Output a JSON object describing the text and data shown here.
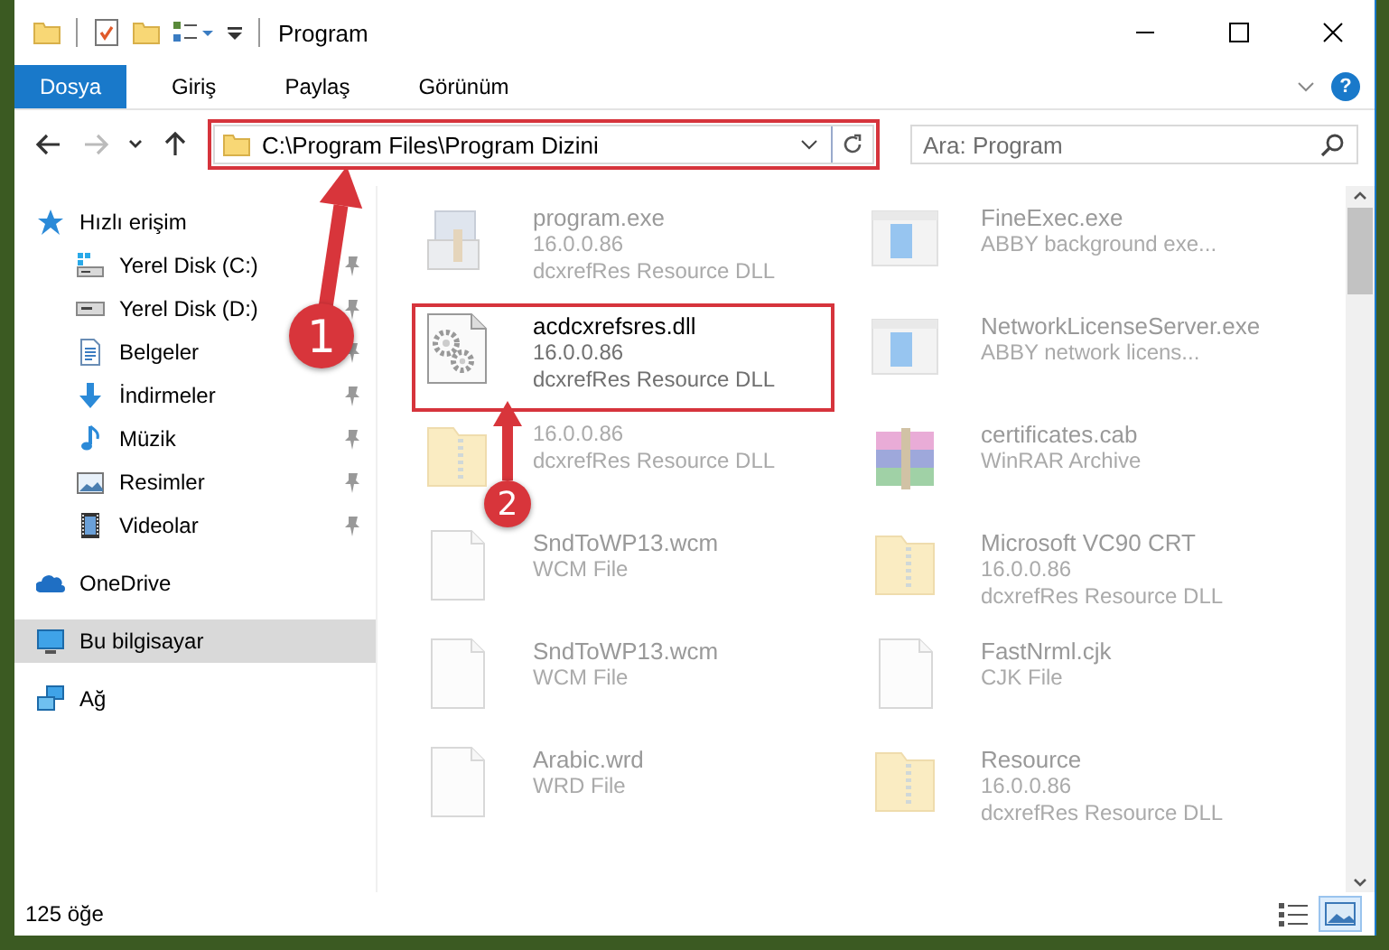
{
  "window": {
    "title": "Program"
  },
  "ribbon": {
    "tabs": [
      {
        "label": "Dosya",
        "selected": true
      },
      {
        "label": "Giriş",
        "selected": false
      },
      {
        "label": "Paylaş",
        "selected": false
      },
      {
        "label": "Görünüm",
        "selected": false
      }
    ],
    "help": "?"
  },
  "navigation": {
    "buttons": [
      {
        "kind": "back",
        "disabled": false
      },
      {
        "kind": "forward",
        "disabled": true
      },
      {
        "kind": "recent",
        "disabled": false
      },
      {
        "kind": "up",
        "disabled": false
      }
    ]
  },
  "address": {
    "value": "C:\\Program Files\\Program Dizini",
    "outlined": true
  },
  "search": {
    "placeholder": "Ara: Program"
  },
  "sidebar": {
    "items": [
      {
        "label": "Hızlı erişim",
        "kind": "star",
        "selected": false,
        "children": [
          {
            "label": "Yerel Disk (C:)",
            "kind": "drive-win",
            "selected": false,
            "pinned": true
          },
          {
            "label": "Yerel Disk (D:)",
            "kind": "drive",
            "selected": false,
            "pinned": true
          },
          {
            "label": "Belgeler",
            "kind": "document",
            "selected": false,
            "pinned": true
          },
          {
            "label": "İndirmeler",
            "kind": "download",
            "selected": false,
            "pinned": true
          },
          {
            "label": "Müzik",
            "kind": "music",
            "selected": false,
            "pinned": true
          },
          {
            "label": "Resimler",
            "kind": "picture",
            "selected": false,
            "pinned": true
          },
          {
            "label": "Videolar",
            "kind": "film",
            "selected": false,
            "pinned": true
          }
        ]
      },
      {
        "label": "OneDrive",
        "kind": "cloud",
        "selected": false
      },
      {
        "label": "Bu bilgisayar",
        "kind": "monitor",
        "selected": true
      },
      {
        "label": "Ağ",
        "kind": "network",
        "selected": false
      }
    ]
  },
  "files": [
    {
      "name": "program.exe",
      "lines": [
        "16.0.0.86",
        "dcxrefRes Resource DLL"
      ],
      "kind": "installer",
      "dimmed": true,
      "outlined": false
    },
    {
      "name": "FineExec.exe",
      "lines": [
        "ABBY background exe..."
      ],
      "kind": "app",
      "dimmed": true,
      "outlined": false
    },
    {
      "name": "acdcxrefsres.dll",
      "lines": [
        "16.0.0.86",
        "dcxrefRes Resource DLL"
      ],
      "kind": "gear",
      "dimmed": false,
      "outlined": true
    },
    {
      "name": "NetworkLicenseServer.exe",
      "lines": [
        "ABBY network licens..."
      ],
      "kind": "app",
      "dimmed": true,
      "outlined": false
    },
    {
      "lines": [
        "16.0.0.86",
        "dcxrefRes Resource DLL"
      ],
      "kind": "zip-folder",
      "dimmed": true,
      "outlined": false
    },
    {
      "name": "certificates.cab",
      "lines": [
        "WinRAR Archive"
      ],
      "kind": "archive",
      "dimmed": true,
      "outlined": false
    },
    {
      "name": "SndToWP13.wcm",
      "lines": [
        "WCM File"
      ],
      "kind": "blank",
      "dimmed": true,
      "outlined": false
    },
    {
      "name": "Microsoft VC90 CRT",
      "lines": [
        "16.0.0.86",
        "dcxrefRes Resource DLL"
      ],
      "kind": "zip-folder",
      "dimmed": true,
      "outlined": false
    },
    {
      "name": "SndToWP13.wcm",
      "lines": [
        "WCM File"
      ],
      "kind": "blank",
      "dimmed": true,
      "outlined": false
    },
    {
      "name": "FastNrml.cjk",
      "lines": [
        "CJK File"
      ],
      "kind": "blank",
      "dimmed": true,
      "outlined": false
    },
    {
      "name": "Arabic.wrd",
      "lines": [
        "WRD File"
      ],
      "kind": "blank",
      "dimmed": true,
      "outlined": false
    },
    {
      "name": "Resource",
      "lines": [
        "16.0.0.86",
        "dcxrefRes Resource DLL"
      ],
      "kind": "zip-folder",
      "dimmed": true,
      "outlined": false
    }
  ],
  "status_bar": {
    "count": "125 öğe",
    "views": [
      {
        "kind": "details",
        "selected": false
      },
      {
        "kind": "large-icons",
        "selected": true
      }
    ]
  },
  "annotations": [
    {
      "number": "1"
    },
    {
      "number": "2"
    }
  ]
}
